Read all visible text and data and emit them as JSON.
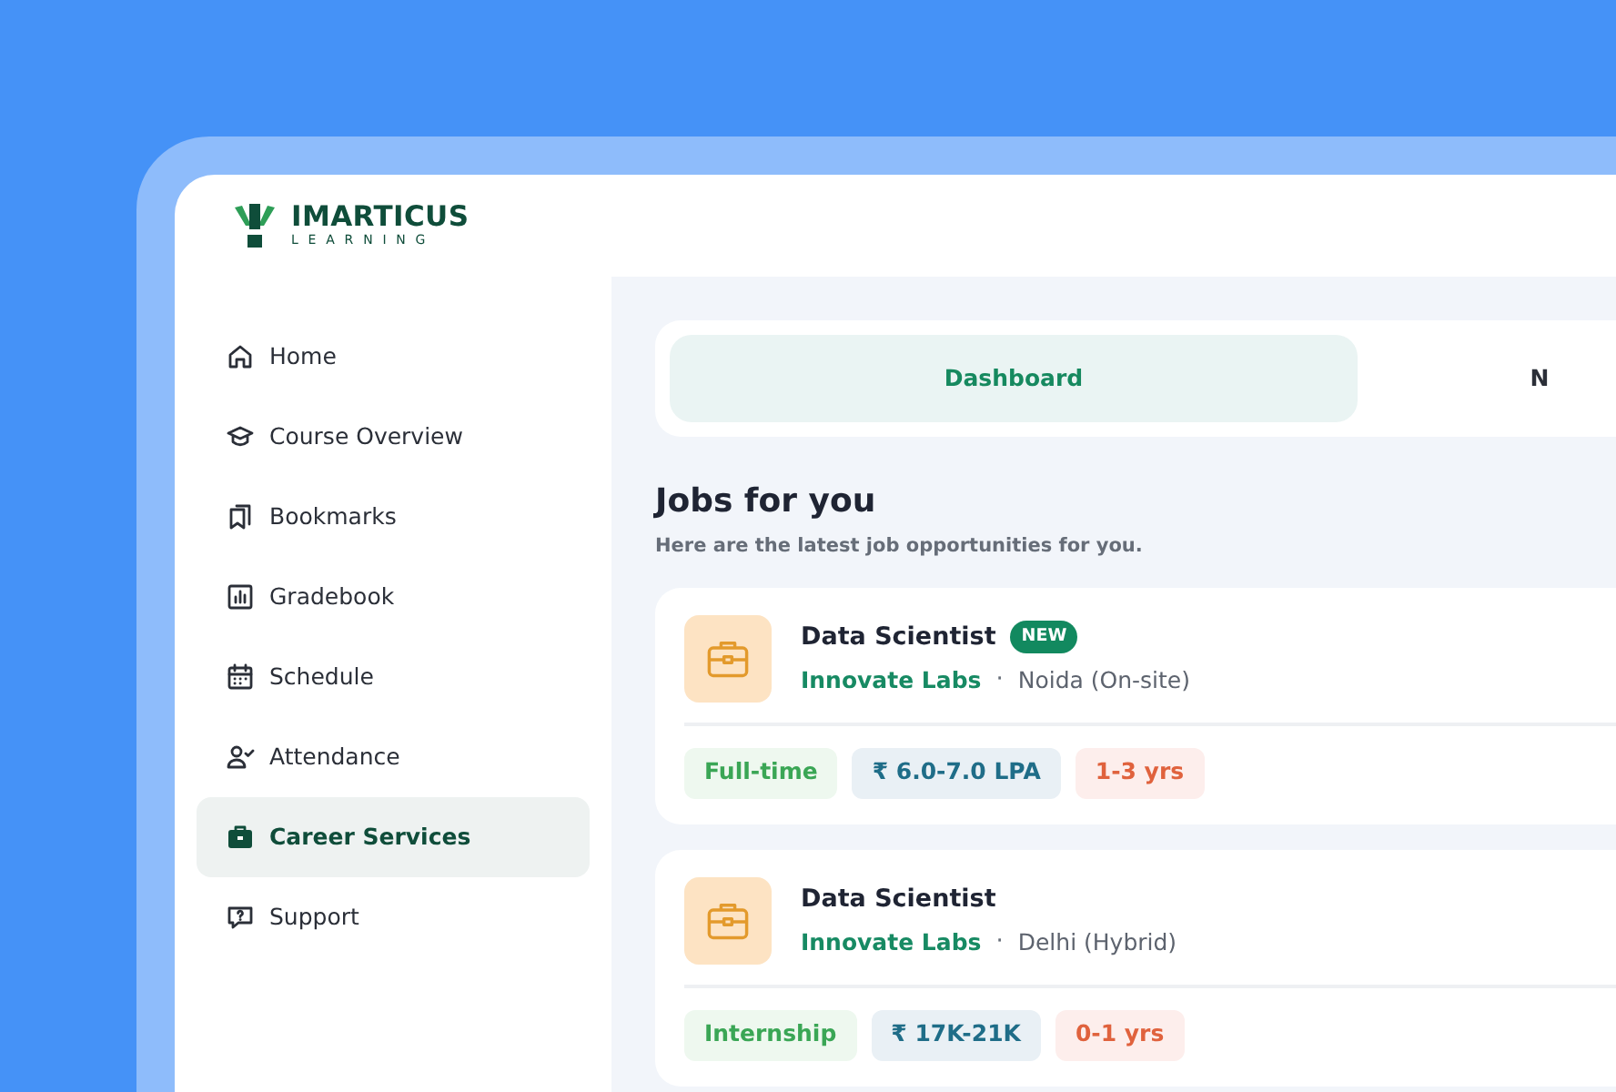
{
  "logo": {
    "name": "IMARTICUS",
    "tagline": "LEARNING"
  },
  "sidebar": {
    "items": [
      {
        "label": "Home",
        "selected": false
      },
      {
        "label": "Course Overview",
        "selected": false
      },
      {
        "label": "Bookmarks",
        "selected": false
      },
      {
        "label": "Gradebook",
        "selected": false
      },
      {
        "label": "Schedule",
        "selected": false
      },
      {
        "label": "Attendance",
        "selected": false
      },
      {
        "label": "Career Services",
        "selected": true
      },
      {
        "label": "Support",
        "selected": false
      }
    ]
  },
  "tabs": [
    {
      "label": "Dashboard",
      "selected": true
    },
    {
      "label": "N",
      "selected": false
    }
  ],
  "section": {
    "title": "Jobs for you",
    "subtitle": "Here are the latest job opportunities for you."
  },
  "jobs": [
    {
      "title": "Data Scientist",
      "is_new": true,
      "badge": "NEW",
      "company": "Innovate Labs",
      "separator": "·",
      "location": "Noida (On-site)",
      "tags": [
        {
          "kind": "type",
          "text": "Full-time"
        },
        {
          "kind": "salary",
          "text": "₹ 6.0-7.0 LPA"
        },
        {
          "kind": "experience",
          "text": "1-3 yrs"
        }
      ]
    },
    {
      "title": "Data Scientist",
      "is_new": false,
      "company": "Innovate Labs",
      "separator": "·",
      "location": "Delhi (Hybrid)",
      "tags": [
        {
          "kind": "type",
          "text": "Internship"
        },
        {
          "kind": "salary",
          "text": "₹ 17K-21K"
        },
        {
          "kind": "experience",
          "text": "0-1 yrs"
        }
      ]
    }
  ]
}
